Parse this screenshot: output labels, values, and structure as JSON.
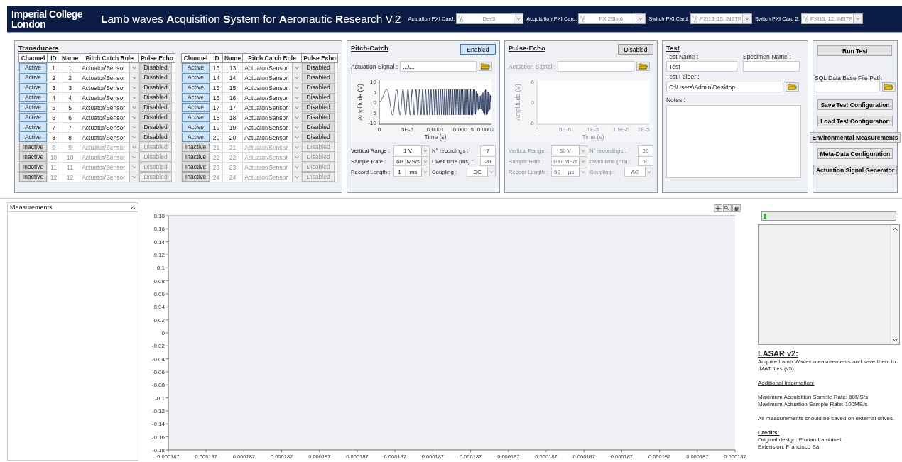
{
  "header": {
    "logo": "Imperial College London",
    "title": "**L**amb waves **A**cquisition **S**ystem for **A**eronautic **R**esearch V.2",
    "cards": [
      {
        "label": "Actuation PXI Card:",
        "value": "Dev3",
        "disabled": true
      },
      {
        "label": "Acquisition PXI Card:",
        "value": "PXI2Slot6",
        "disabled": true
      },
      {
        "label": "Switch PXI Card:",
        "value": "PXI13::15::INSTR",
        "disabled": true
      },
      {
        "label": "Switch PXI Card 2:",
        "value": "PXI13::12::INSTR",
        "disabled": true
      }
    ]
  },
  "transducers": {
    "title": "Transducers",
    "tables": [
      {
        "columns": [
          "Channel",
          "ID",
          "Name",
          "Pitch Catch Role",
          "Pulse Echo"
        ],
        "rows": [
          {
            "channel": "Active",
            "id": "1",
            "name": "1",
            "role": "Actuator/Sensor",
            "pulse_echo": "Disabled",
            "active": true
          },
          {
            "channel": "Active",
            "id": "2",
            "name": "2",
            "role": "Actuator/Sensor",
            "pulse_echo": "Disabled",
            "active": true
          },
          {
            "channel": "Active",
            "id": "3",
            "name": "3",
            "role": "Actuator/Sensor",
            "pulse_echo": "Disabled",
            "active": true
          },
          {
            "channel": "Active",
            "id": "4",
            "name": "4",
            "role": "Actuator/Sensor",
            "pulse_echo": "Disabled",
            "active": true
          },
          {
            "channel": "Active",
            "id": "5",
            "name": "5",
            "role": "Actuator/Sensor",
            "pulse_echo": "Disabled",
            "active": true
          },
          {
            "channel": "Active",
            "id": "6",
            "name": "6",
            "role": "Actuator/Sensor",
            "pulse_echo": "Disabled",
            "active": true
          },
          {
            "channel": "Active",
            "id": "7",
            "name": "7",
            "role": "Actuator/Sensor",
            "pulse_echo": "Disabled",
            "active": true
          },
          {
            "channel": "Active",
            "id": "8",
            "name": "8",
            "role": "Actuator/Sensor",
            "pulse_echo": "Disabled",
            "active": true
          },
          {
            "channel": "Inactive",
            "id": "9",
            "name": "9",
            "role": "Actuator/Sensor",
            "pulse_echo": "Disabled",
            "active": false
          },
          {
            "channel": "Inactive",
            "id": "10",
            "name": "10",
            "role": "Actuator/Sensor",
            "pulse_echo": "Disabled",
            "active": false
          },
          {
            "channel": "Inactive",
            "id": "11",
            "name": "11",
            "role": "Actuator/Sensor",
            "pulse_echo": "Disabled",
            "active": false
          },
          {
            "channel": "Inactive",
            "id": "12",
            "name": "12",
            "role": "Actuator/Sensor",
            "pulse_echo": "Disabled",
            "active": false
          }
        ]
      },
      {
        "columns": [
          "Channel",
          "ID",
          "Name",
          "Pitch Catch Role",
          "Pulse Echo"
        ],
        "rows": [
          {
            "channel": "Active",
            "id": "13",
            "name": "13",
            "role": "Actuator/Sensor",
            "pulse_echo": "Disabled",
            "active": true
          },
          {
            "channel": "Active",
            "id": "14",
            "name": "14",
            "role": "Actuator/Sensor",
            "pulse_echo": "Disabled",
            "active": true
          },
          {
            "channel": "Active",
            "id": "15",
            "name": "15",
            "role": "Actuator/Sensor",
            "pulse_echo": "Disabled",
            "active": true
          },
          {
            "channel": "Active",
            "id": "16",
            "name": "16",
            "role": "Actuator/Sensor",
            "pulse_echo": "Disabled",
            "active": true
          },
          {
            "channel": "Active",
            "id": "17",
            "name": "17",
            "role": "Actuator/Sensor",
            "pulse_echo": "Disabled",
            "active": true
          },
          {
            "channel": "Active",
            "id": "18",
            "name": "18",
            "role": "Actuator/Sensor",
            "pulse_echo": "Disabled",
            "active": true
          },
          {
            "channel": "Active",
            "id": "19",
            "name": "19",
            "role": "Actuator/Sensor",
            "pulse_echo": "Disabled",
            "active": true
          },
          {
            "channel": "Active",
            "id": "20",
            "name": "20",
            "role": "Actuator/Sensor",
            "pulse_echo": "Disabled",
            "active": true
          },
          {
            "channel": "Inactive",
            "id": "21",
            "name": "21",
            "role": "Actuator/Sensor",
            "pulse_echo": "Disabled",
            "active": false
          },
          {
            "channel": "Inactive",
            "id": "22",
            "name": "22",
            "role": "Actuator/Sensor",
            "pulse_echo": "Disabled",
            "active": false
          },
          {
            "channel": "Inactive",
            "id": "23",
            "name": "23",
            "role": "Actuator/Sensor",
            "pulse_echo": "Disabled",
            "active": false
          },
          {
            "channel": "Inactive",
            "id": "24",
            "name": "24",
            "role": "Actuator/Sensor",
            "pulse_echo": "Disabled",
            "active": false
          }
        ]
      }
    ]
  },
  "modes": [
    {
      "title": "Pitch-Catch",
      "toggle": {
        "label": "Enabled",
        "on": true
      },
      "disabled": false,
      "signal": {
        "label": "Actuation Signal :",
        "value": "...\\..."
      },
      "chart": {
        "ylabel": "Amplitude (V)",
        "xlabel": "Time (s)",
        "yticks": [
          "10",
          "5",
          "0",
          "-5",
          "-10"
        ],
        "xticks": [
          "0",
          "5E-5",
          "0.0001",
          "0.00015",
          "0.0002"
        ],
        "trace": true
      },
      "settings": [
        {
          "kind": "dropdown",
          "label": "Vertical Range :",
          "value": "1 V"
        },
        {
          "kind": "numeric",
          "label": "N° recordings :",
          "value": "7"
        },
        {
          "kind": "unit_dropdown",
          "label": "Sample Rate :",
          "value": "60",
          "unit": "MS/s"
        },
        {
          "kind": "numeric",
          "label": "Dwell time (ms) :",
          "value": "20"
        },
        {
          "kind": "unit_dropdown",
          "label": "Record Length :",
          "value": "1",
          "unit": "ms"
        },
        {
          "kind": "dropdown",
          "label": "Coupling :",
          "value": "DC"
        }
      ]
    },
    {
      "title": "Pulse-Echo",
      "toggle": {
        "label": "Disabled",
        "on": false
      },
      "disabled": true,
      "signal": {
        "label": "Actuation Signal :"
      },
      "chart": {
        "ylabel": "Amplitude (V)",
        "xlabel": "Time (s)",
        "yticks": [
          "6",
          "0",
          "-6"
        ],
        "xticks": [
          "0",
          "5E-6",
          "1E-5",
          "1.5E-5",
          "2E-5"
        ],
        "trace": false
      },
      "settings": [
        {
          "kind": "dropdown",
          "label": "Vertical Range :",
          "value": "30 V"
        },
        {
          "kind": "numeric",
          "label": "N° recordings :",
          "value": "50"
        },
        {
          "kind": "unit_dropdown",
          "label": "Sample Rate :",
          "value": "100",
          "unit": "MS/s"
        },
        {
          "kind": "numeric",
          "label": "Dwell time (ms) :",
          "value": "50"
        },
        {
          "kind": "unit_dropdown",
          "label": "Record Length :",
          "value": "50",
          "unit": "µs"
        },
        {
          "kind": "dropdown",
          "label": "Coupling :",
          "value": "AC"
        }
      ]
    }
  ],
  "test": {
    "title": "Test",
    "fields": [
      {
        "kind": "text",
        "label": "Test Name :",
        "value": "Test"
      },
      {
        "kind": "text",
        "label": "Specimen Name :"
      },
      {
        "kind": "path",
        "label": "Test Folder :",
        "value": "C:\\Users\\Admin\\Desktop"
      },
      {
        "kind": "notes",
        "label": "Notes :"
      }
    ]
  },
  "actions": {
    "run": "Run Test",
    "sql_label": "SQL Data Base File Path",
    "buttons": [
      "Save Test Configuration",
      "Load Test Configuration",
      "Environmental Measurements",
      "Meta-Data Configuration",
      "Actuation Signal Generator"
    ]
  },
  "measurements": {
    "title": "Measurements"
  },
  "main_chart": {
    "chart_data": {
      "type": "line",
      "ylim": [
        -0.18,
        0.18
      ],
      "categories": [
        "0.000187",
        "0.000187",
        "0.000187",
        "0.000187",
        "0.000187",
        "0.000187",
        "0.000187",
        "0.000187",
        "0.000187",
        "0.000187",
        "0.000187",
        "0.000187",
        "0.000187",
        "0.000187",
        "0.000187",
        "0.000187"
      ],
      "yticks": [
        0.18,
        0.16,
        0.14,
        0.12,
        0.1,
        0.08,
        0.06,
        0.04,
        0.02,
        0,
        -0.02,
        -0.04,
        -0.06,
        -0.08,
        -0.1,
        -0.12,
        -0.14,
        -0.16,
        -0.18
      ]
    }
  },
  "progress": {
    "level": 0.02
  },
  "info": [
    {
      "kind": "heading",
      "text": "LASAR v2:"
    },
    {
      "kind": "text",
      "text": "Acquire Lamb Waves measurements and save them to .MAT files (v5)"
    },
    {
      "kind": "note",
      "text": "Additional Information:"
    },
    {
      "kind": "line",
      "text": "Maximum Acquisition Sample Rate: 60MS/s"
    },
    {
      "kind": "text",
      "text": "Maximum Actuation Sample Rate: 100MS/s"
    },
    {
      "kind": "text",
      "text": "All measurements should be saved on external drives."
    },
    {
      "kind": "title",
      "text": "Credits:"
    },
    {
      "kind": "line",
      "text": "Original design: Florian Lambinet"
    },
    {
      "kind": "line",
      "text": "Extension: Francisco Sá"
    }
  ]
}
